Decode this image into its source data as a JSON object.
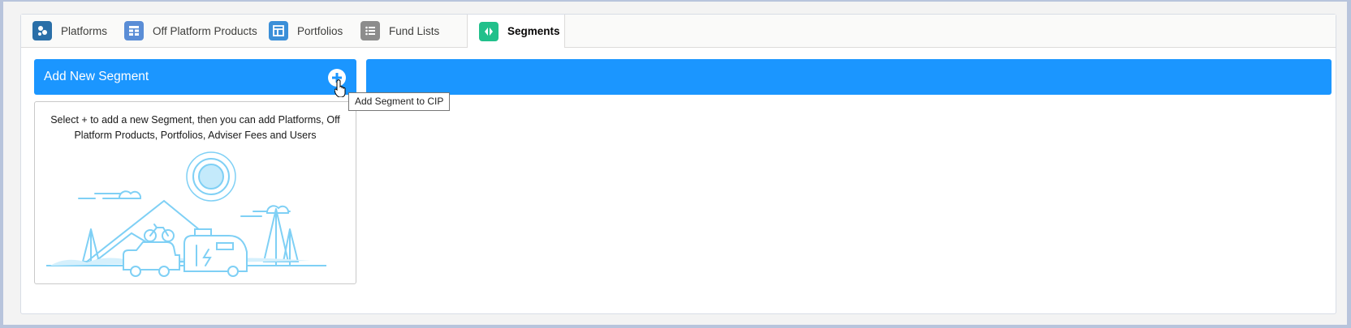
{
  "tabs": [
    {
      "label": "Platforms",
      "icon": "platforms-icon",
      "color": "#2a6fa8"
    },
    {
      "label": "Off Platform Products",
      "icon": "table-icon",
      "color": "#5a8dd6"
    },
    {
      "label": "Portfolios",
      "icon": "portfolio-icon",
      "color": "#3b8fd8"
    },
    {
      "label": "Fund Lists",
      "icon": "list-icon",
      "color": "#8c8c8c"
    },
    {
      "label": "Segments",
      "icon": "segments-icon",
      "color": "#21c08b",
      "active": true
    }
  ],
  "segment_panel": {
    "header_title": "Add New Segment",
    "add_tooltip": "Add Segment to CIP",
    "empty_message": "Select + to add a new Segment, then you can add Platforms, Off Platform Products, Portfolios, Adviser Fees and Users"
  },
  "colors": {
    "header_blue": "#1b96ff",
    "illustration": "#7fd0f5"
  }
}
